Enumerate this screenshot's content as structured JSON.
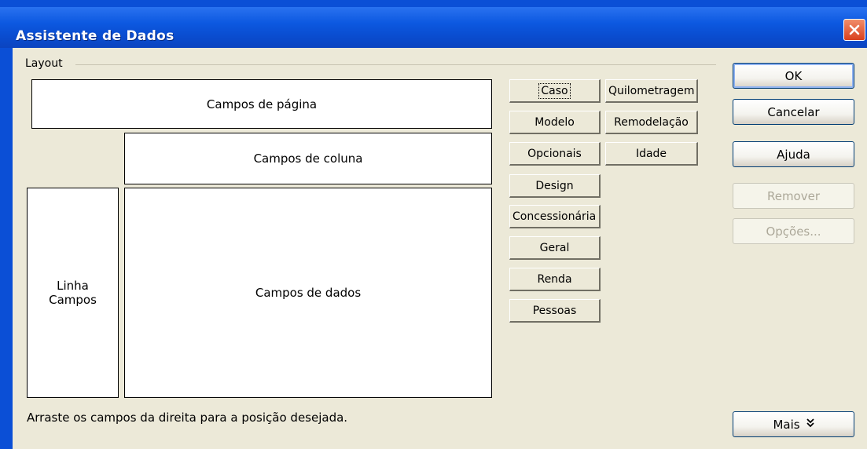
{
  "window": {
    "title": "Assistente de Dados",
    "close_icon": "close-icon"
  },
  "layout": {
    "group_label": "Layout",
    "page_fields": "Campos de página",
    "column_fields": "Campos de coluna",
    "row_fields_line1": "Linha",
    "row_fields_line2": "Campos",
    "data_fields": "Campos de dados"
  },
  "fields": {
    "col1": [
      "Caso",
      "Modelo",
      "Opcionais",
      "Design",
      "Concessionária",
      "Geral",
      "Renda",
      "Pessoas"
    ],
    "col2": [
      "Quilometragem",
      "Remodelação",
      "Idade"
    ]
  },
  "buttons": {
    "ok": "OK",
    "cancel": "Cancelar",
    "help": "Ajuda",
    "remove": "Remover",
    "options": "Opções...",
    "more": "Mais"
  },
  "hint": "Arraste os campos da direita para a posição desejada.",
  "colors": {
    "title_bar": "#0c58e0",
    "dialog_bg": "#ece9d8",
    "close_button": "#d9401e"
  }
}
